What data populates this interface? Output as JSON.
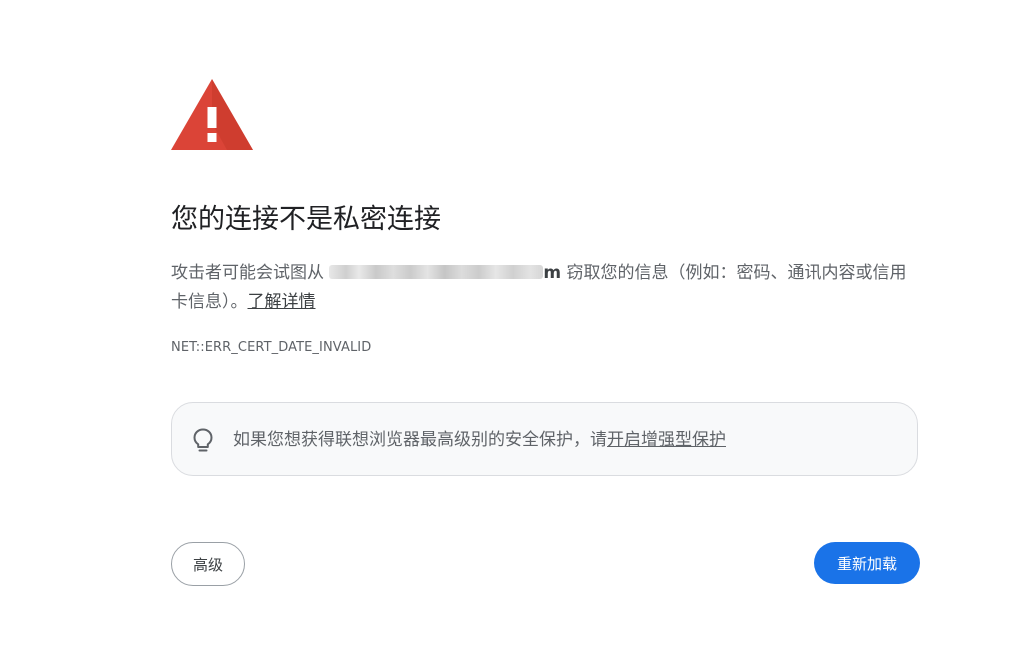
{
  "colors": {
    "warning_red": "#db4437",
    "primary_blue": "#1a73e8",
    "text_primary": "#202124",
    "text_secondary": "#5f6368"
  },
  "icons": {
    "warning": "warning-triangle-icon",
    "tip": "lightbulb-icon"
  },
  "main": {
    "title": "您的连接不是私密连接",
    "description_prefix": "攻击者可能会试图从 ",
    "domain_visible_tail": "m",
    "description_suffix": " 窃取您的信息（例如：密码、通讯内容或信用卡信息）。",
    "learn_more": "了解详情",
    "error_code": "NET::ERR_CERT_DATE_INVALID"
  },
  "enhanced_protection": {
    "text": "如果您想获得联想浏览器最高级别的安全保护，请",
    "link": "开启增强型保护"
  },
  "buttons": {
    "advanced": "高级",
    "reload": "重新加载"
  }
}
